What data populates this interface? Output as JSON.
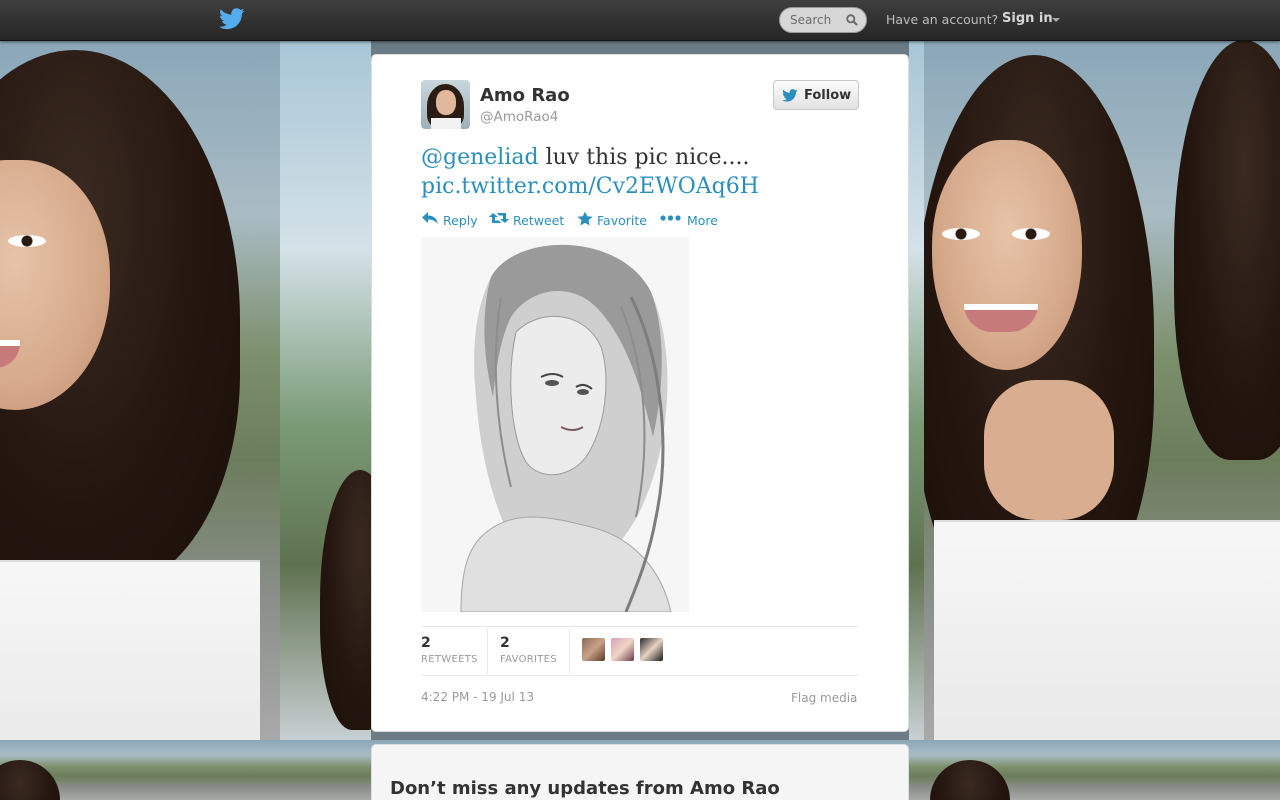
{
  "topbar": {
    "search_placeholder": "Search",
    "have_account": "Have an account?",
    "sign_in": "Sign in",
    "logo_icon": "twitter-bird-icon",
    "search_icon": "magnifier-icon"
  },
  "tweet": {
    "author_name": "Amo Rao",
    "author_handle": "@AmoRao4",
    "follow_label": "Follow",
    "mention": "@geneliad",
    "text": "luv this pic nice....",
    "link": "pic.twitter.com/Cv2EWOAq6H",
    "actions": [
      {
        "label": "Reply",
        "icon": "reply-arrow-icon"
      },
      {
        "label": "Retweet",
        "icon": "retweet-icon"
      },
      {
        "label": "Favorite",
        "icon": "star-icon"
      },
      {
        "label": "More",
        "icon": "ellipsis-icon"
      }
    ],
    "stats": {
      "retweets_count": "2",
      "retweets_label": "RETWEETS",
      "favorites_count": "2",
      "favorites_label": "FAVORITES"
    },
    "timestamp": "4:22 PM - 19 Jul 13",
    "flag_media": "Flag media"
  },
  "promo": {
    "heading": "Don’t miss any updates from Amo Rao"
  },
  "colors": {
    "link": "#2a8fbd",
    "twitter_blue": "#55acee",
    "topbar": "#2c2c2c"
  }
}
